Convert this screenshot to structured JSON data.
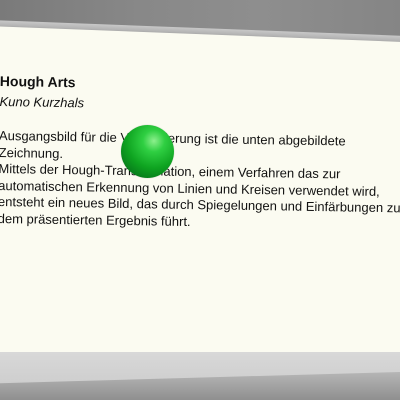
{
  "card": {
    "title": "Hough Arts",
    "author": "Kuno Kurzhals",
    "description_lines": [
      "Ausgangsbild für die Visualisierung ist die unten abgebildete",
      "Zeichnung.",
      "Mittels der Hough-Transformation, einem Verfahren das zur",
      "automatischen Erkennung von Linien und Kreisen verwendet wird,",
      "entsteht ein neues Bild, das durch Spiegelungen und Einfärbungen zu",
      "dem präsentierten Ergebnis führt."
    ]
  },
  "colors": {
    "panel": "#fbfbf1",
    "background": "#888888",
    "orb": "#0ea320",
    "text": "#111111"
  }
}
